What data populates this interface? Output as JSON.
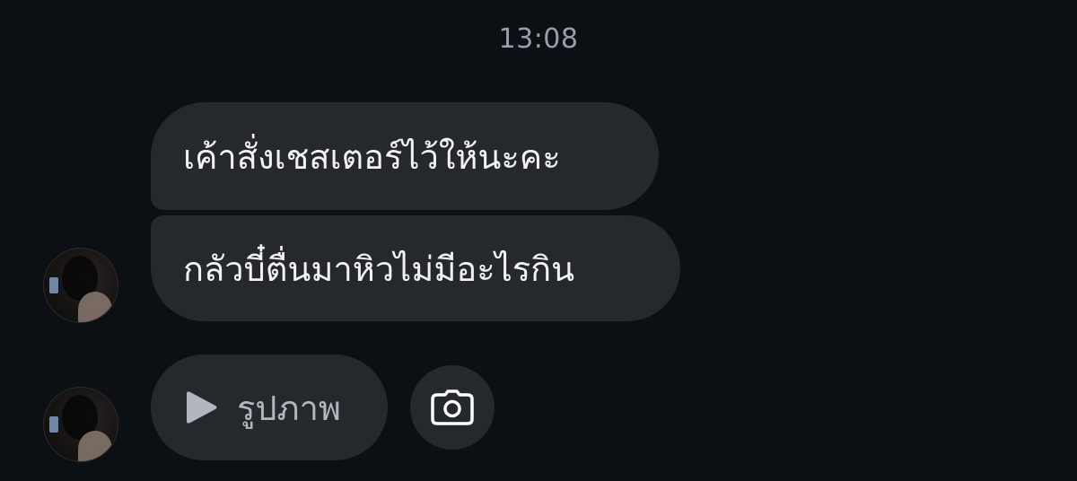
{
  "conversation": {
    "timestamp": "13:08",
    "messages": [
      {
        "text": "เค้าสั่งเชสเตอร์ไว้ให้นะคะ"
      },
      {
        "text": "กลัวบี๋ตื่นมาหิวไม่มีอะไรกิน"
      }
    ],
    "media": {
      "label": "รูปภาพ",
      "icon": "play-icon"
    },
    "camera": {
      "icon": "camera-icon"
    }
  },
  "colors": {
    "background": "#0c0f13",
    "bubble": "#25282d",
    "text": "#f2f2f2",
    "muted_text": "#9a9ea6"
  }
}
